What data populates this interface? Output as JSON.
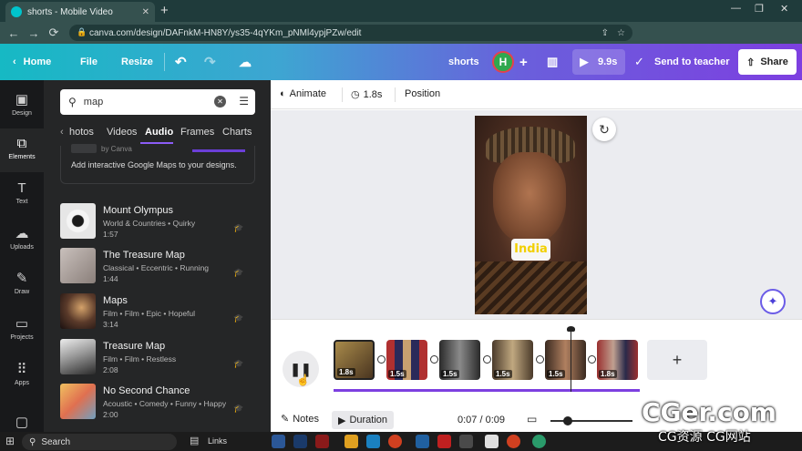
{
  "browser": {
    "tab_title": "shorts - Mobile Video",
    "url": "canva.com/design/DAFnkM-HN8Y/ys35-4qYKm_pNMl4ypjPZw/edit"
  },
  "header": {
    "home": "Home",
    "file": "File",
    "resize": "Resize",
    "design_name": "shorts",
    "avatar_letter": "H",
    "play_time": "9.9s",
    "send_to_teacher": "Send to teacher",
    "share": "Share"
  },
  "rail": {
    "items": [
      {
        "label": "Design",
        "icon": "design-icon"
      },
      {
        "label": "Elements",
        "icon": "elements-icon"
      },
      {
        "label": "Text",
        "icon": "text-icon"
      },
      {
        "label": "Uploads",
        "icon": "upload-icon"
      },
      {
        "label": "Draw",
        "icon": "draw-icon"
      },
      {
        "label": "Projects",
        "icon": "folder-icon"
      },
      {
        "label": "Apps",
        "icon": "apps-icon"
      }
    ]
  },
  "panel": {
    "search_value": "map",
    "tabs": [
      "hotos",
      "Videos",
      "Audio",
      "Frames",
      "Charts"
    ],
    "active_tab": "Audio",
    "maps_partial": "by Canva",
    "maps_desc": "Add interactive Google Maps to your designs.",
    "tracks": [
      {
        "title": "Mount Olympus",
        "meta": "World & Countries • Quirky",
        "duration": "1:57"
      },
      {
        "title": "The Treasure Map",
        "meta": "Classical • Eccentric • Running",
        "duration": "1:44"
      },
      {
        "title": "Maps",
        "meta": "Film • Film • Epic • Hopeful",
        "duration": "3:14"
      },
      {
        "title": "Treasure Map",
        "meta": "Film • Film • Restless",
        "duration": "2:08"
      },
      {
        "title": "No Second Chance",
        "meta": "Acoustic • Comedy • Funny • Happy",
        "duration": "2:00"
      }
    ]
  },
  "toolbar": {
    "animate": "Animate",
    "duration": "1.8s",
    "position": "Position"
  },
  "canvas": {
    "overlay_text": "India"
  },
  "timeline": {
    "clips": [
      "1.8s",
      "1.5s",
      "1.5s",
      "1.5s",
      "1.5s",
      "1.8s"
    ]
  },
  "bottom": {
    "notes": "Notes",
    "duration": "Duration",
    "time": "0:07 / 0:09"
  },
  "taskbar": {
    "search": "Search",
    "links": "Links"
  },
  "watermark": {
    "line1": "CGer.com",
    "line2": "CG资源 CG网站"
  },
  "colors": {
    "header_start": "#16b9c4",
    "header_end": "#7d3fe0",
    "accent": "#7d3fe0",
    "panel_bg": "#252627"
  }
}
